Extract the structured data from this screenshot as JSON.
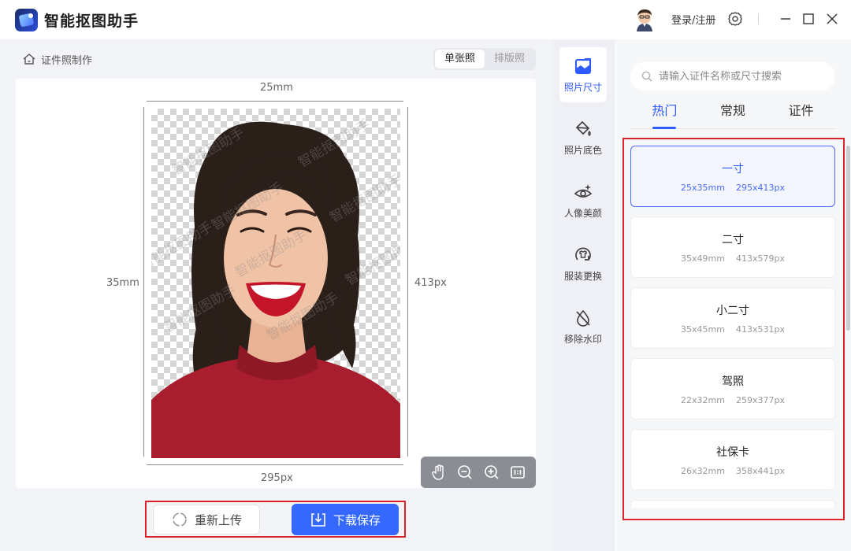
{
  "app": {
    "title": "智能抠图助手",
    "login_label": "登录/注册"
  },
  "breadcrumb": {
    "label": "证件照制作"
  },
  "mode_toggle": [
    {
      "label": "单张照",
      "active": true
    },
    {
      "label": "排版照",
      "active": false
    }
  ],
  "canvas": {
    "width_mm": "25mm",
    "height_mm": "35mm",
    "width_px": "295px",
    "height_px": "413px",
    "watermark": "智能抠图助手"
  },
  "actions": {
    "reupload_label": "重新上传",
    "download_label": "下载保存"
  },
  "tools": [
    {
      "label": "照片尺寸",
      "icon": "photo-size-icon",
      "active": true
    },
    {
      "label": "照片底色",
      "icon": "paint-bucket-icon",
      "active": false
    },
    {
      "label": "人像美颜",
      "icon": "eye-sparkle-icon",
      "active": false
    },
    {
      "label": "服装更换",
      "icon": "shirt-swap-icon",
      "active": false
    },
    {
      "label": "移除水印",
      "icon": "drop-remove-icon",
      "active": false
    }
  ],
  "search": {
    "placeholder": "请输入证件名称或尺寸搜索"
  },
  "tabs": [
    {
      "label": "热门",
      "active": true
    },
    {
      "label": "常规",
      "active": false
    },
    {
      "label": "证件",
      "active": false
    }
  ],
  "sizes": [
    {
      "name": "一寸",
      "mm": "25x35mm",
      "px": "295x413px",
      "active": true
    },
    {
      "name": "二寸",
      "mm": "35x49mm",
      "px": "413x579px",
      "active": false
    },
    {
      "name": "小二寸",
      "mm": "35x45mm",
      "px": "413x531px",
      "active": false
    },
    {
      "name": "驾照",
      "mm": "22x32mm",
      "px": "259x377px",
      "active": false
    },
    {
      "name": "社保卡",
      "mm": "26x32mm",
      "px": "358x441px",
      "active": false
    }
  ],
  "colors": {
    "accent": "#2e5bff",
    "highlight_frame": "#d8242c"
  }
}
